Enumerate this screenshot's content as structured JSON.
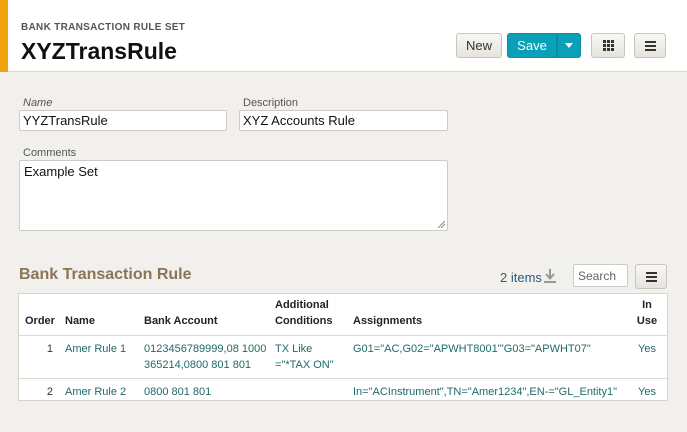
{
  "header": {
    "subtitle": "BANK TRANSACTION RULE SET",
    "title": "XYZTransRule",
    "accent_color": "#f0a30a"
  },
  "toolbar": {
    "new_label": "New",
    "save_label": "Save",
    "save_color": "#0aa0b8"
  },
  "form": {
    "name_label": "Name",
    "name_value": "YYZTransRule",
    "description_label": "Description",
    "description_value": "XYZ Accounts Rule",
    "comments_label": "Comments",
    "comments_value": "Example Set"
  },
  "section": {
    "title": "Bank Transaction Rule",
    "items_count": "2 items",
    "search_placeholder": "Search"
  },
  "table": {
    "headers": {
      "order": "Order",
      "name": "Name",
      "bank_account": "Bank Account",
      "additional_conditions_1": "Additional",
      "additional_conditions_2": "Conditions",
      "assignments": "Assignments",
      "in_use": "In Use"
    },
    "rows": [
      {
        "order": "1",
        "name": "Amer Rule 1",
        "bank_account_1": "0123456789999,08 1000",
        "bank_account_2": "365214,0800 801 801",
        "conditions_1": "TX Like",
        "conditions_2": "=\"*TAX ON\"",
        "assignments": "G01=\"AC,G02=\"APWHT8001\"'G03=\"APWHT07\"",
        "in_use": "Yes"
      },
      {
        "order": "2",
        "name": "Amer Rule 2",
        "bank_account_1": "0800 801 801",
        "bank_account_2": "",
        "conditions_1": "",
        "conditions_2": "",
        "assignments": "In=\"ACInstrument\",TN=\"Amer1234\",EN-=\"GL_Entity1\"",
        "in_use": "Yes"
      }
    ]
  },
  "icons": {
    "save_dropdown": "chevron-down-icon",
    "layout": "grid-icon",
    "menu": "hamburger-menu-icon",
    "download": "download-icon"
  }
}
